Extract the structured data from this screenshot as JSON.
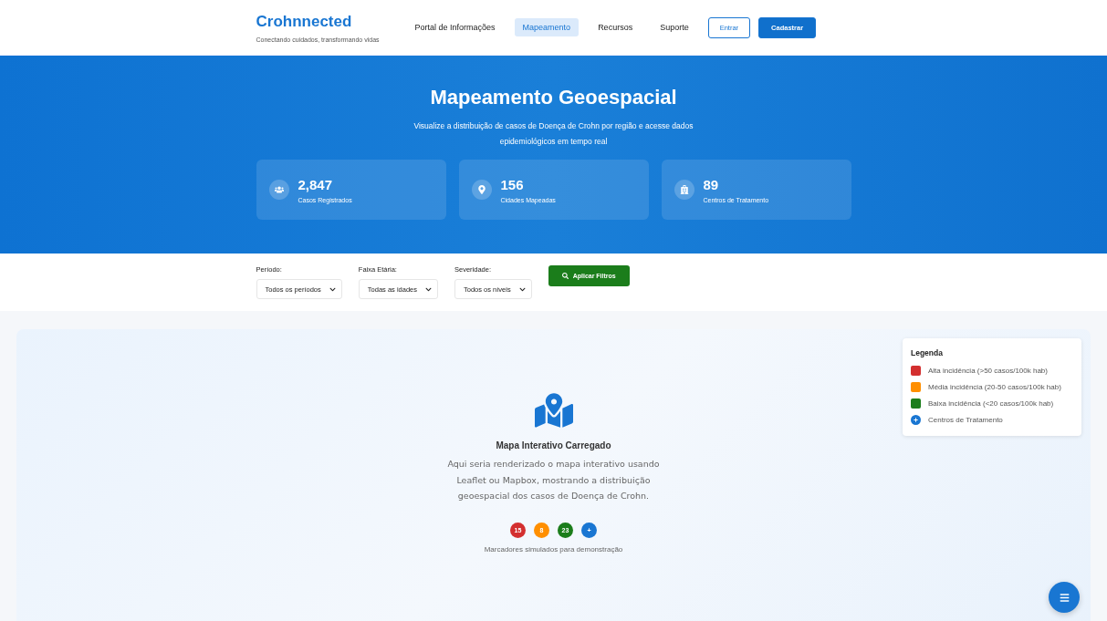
{
  "brand": {
    "name": "Crohnnected",
    "tagline": "Conectando cuidados, transformando vidas"
  },
  "nav": [
    {
      "label": "Portal de Informações",
      "selected": false
    },
    {
      "label": "Mapeamento",
      "selected": true
    },
    {
      "label": "Recursos",
      "selected": false
    },
    {
      "label": "Suporte",
      "selected": false
    }
  ],
  "auth_buttons": [
    {
      "label": "Entrar",
      "kind": "outline"
    },
    {
      "label": "Cadastrar",
      "kind": "solid"
    }
  ],
  "hero": {
    "title": "Mapeamento Geoespacial",
    "subtitle": "Visualize a distribuição de casos de Doença de Crohn por região e acesse dados epidemiológicos em tempo real"
  },
  "stats": [
    {
      "kind": "people",
      "value": "2,847",
      "label": "Casos Registrados"
    },
    {
      "kind": "pin",
      "value": "156",
      "label": "Cidades Mapeadas"
    },
    {
      "kind": "hospital",
      "value": "89",
      "label": "Centros de Tratamento"
    }
  ],
  "filters": [
    {
      "label": "Período:",
      "value": "Todos os períodos"
    },
    {
      "label": "Faixa Etária:",
      "value": "Todas as idades"
    },
    {
      "label": "Severidade:",
      "value": "Todos os níveis"
    }
  ],
  "apply_button": "Aplicar Filtros",
  "map": {
    "title": "Mapa Interativo Carregado",
    "description": "Aqui seria renderizado o mapa interativo usando Leaflet ou Mapbox, mostrando a distribuição geoespacial dos casos de Doença de Crohn.",
    "markers": [
      {
        "label": "15",
        "color": "#d32f2f"
      },
      {
        "label": "8",
        "color": "#ff8f00"
      },
      {
        "label": "23",
        "color": "#1b7d1b"
      },
      {
        "label": "+",
        "color": "#1976d2"
      }
    ],
    "markers_caption": "Marcadores simulados para demonstração"
  },
  "legend": {
    "title": "Legenda",
    "items": [
      {
        "kind": "square",
        "color": "#d32f2f",
        "label": "Alta incidência (>50 casos/100k hab)"
      },
      {
        "kind": "square",
        "color": "#ff8f00",
        "label": "Média incidência (20-50 casos/100k hab)"
      },
      {
        "kind": "square",
        "color": "#1b7d1b",
        "label": "Baixa incidência (<20 casos/100k hab)"
      },
      {
        "kind": "circle",
        "color": "#1976d2",
        "label": "Centros de Tratamento"
      }
    ]
  }
}
